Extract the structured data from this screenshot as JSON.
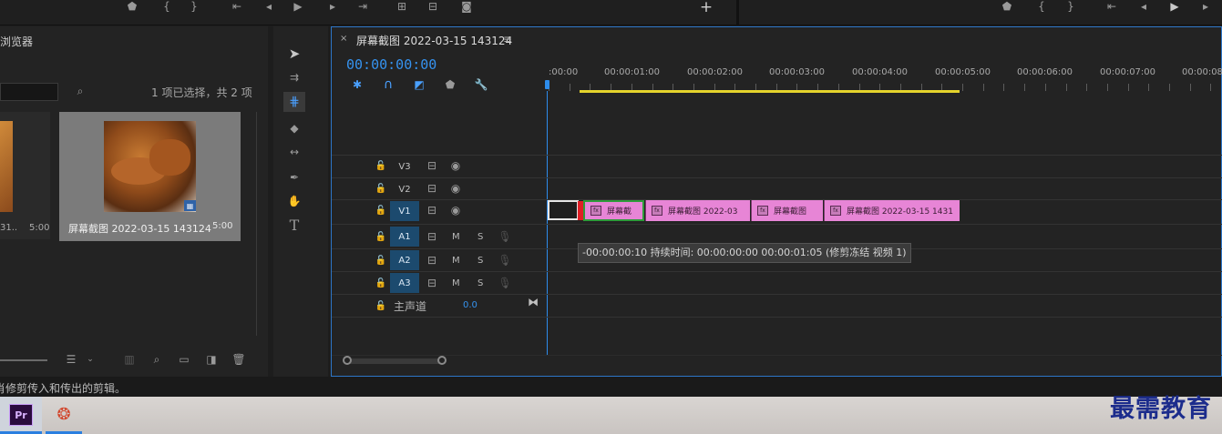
{
  "monitor_bar": {},
  "project_panel": {
    "title": "浏览器",
    "selection_status": "1 项已选择，共 2 项",
    "items": [
      {
        "name": "屏幕截图 2022-03-15 143124",
        "duration": "5:00",
        "selected": true
      },
      {
        "name": "31...",
        "duration": "5:00",
        "selected": false
      }
    ]
  },
  "tools": [
    "selection-tool",
    "track-select-tool",
    "ripple-edit-tool",
    "razor-tool",
    "slip-tool",
    "pen-tool",
    "hand-tool",
    "type-tool"
  ],
  "timeline": {
    "tab_close": "×",
    "tab_title": "屏幕截图 2022-03-15 143124",
    "tab_menu": "≡",
    "timecode": "00:00:00:00",
    "ruler_labels": [
      ":00:00",
      "00:00:01:00",
      "00:00:02:00",
      "00:00:03:00",
      "00:00:04:00",
      "00:00:05:00",
      "00:00:06:00",
      "00:00:07:00",
      "00:00:08"
    ],
    "video_tracks": [
      "V3",
      "V2",
      "V1"
    ],
    "audio_tracks": [
      "A1",
      "A2",
      "A3"
    ],
    "mute_label": "M",
    "solo_label": "S",
    "master_label": "主声道",
    "master_value": "0.0",
    "clips": [
      {
        "label": "屏幕截",
        "fx": "fx"
      },
      {
        "label": "屏幕截图 2022-03",
        "fx": "fx"
      },
      {
        "label": "屏幕截图",
        "fx": "fx"
      },
      {
        "label": "屏幕截图 2022-03-15 1431",
        "fx": "fx"
      }
    ],
    "tooltip": "-00:00:00:10 持续时间: 00:00:00:00 00:00:01:05 (修剪冻结 视频 1)"
  },
  "status_bar": {
    "text": "肖修剪传入和传出的剪辑。"
  },
  "taskbar": {
    "premiere_label": "Pr"
  },
  "watermark": {
    "text": "最需教育"
  },
  "colors": {
    "accent": "#2d8ceb",
    "clip": "#e785d6",
    "work_area": "#e4d32c"
  }
}
